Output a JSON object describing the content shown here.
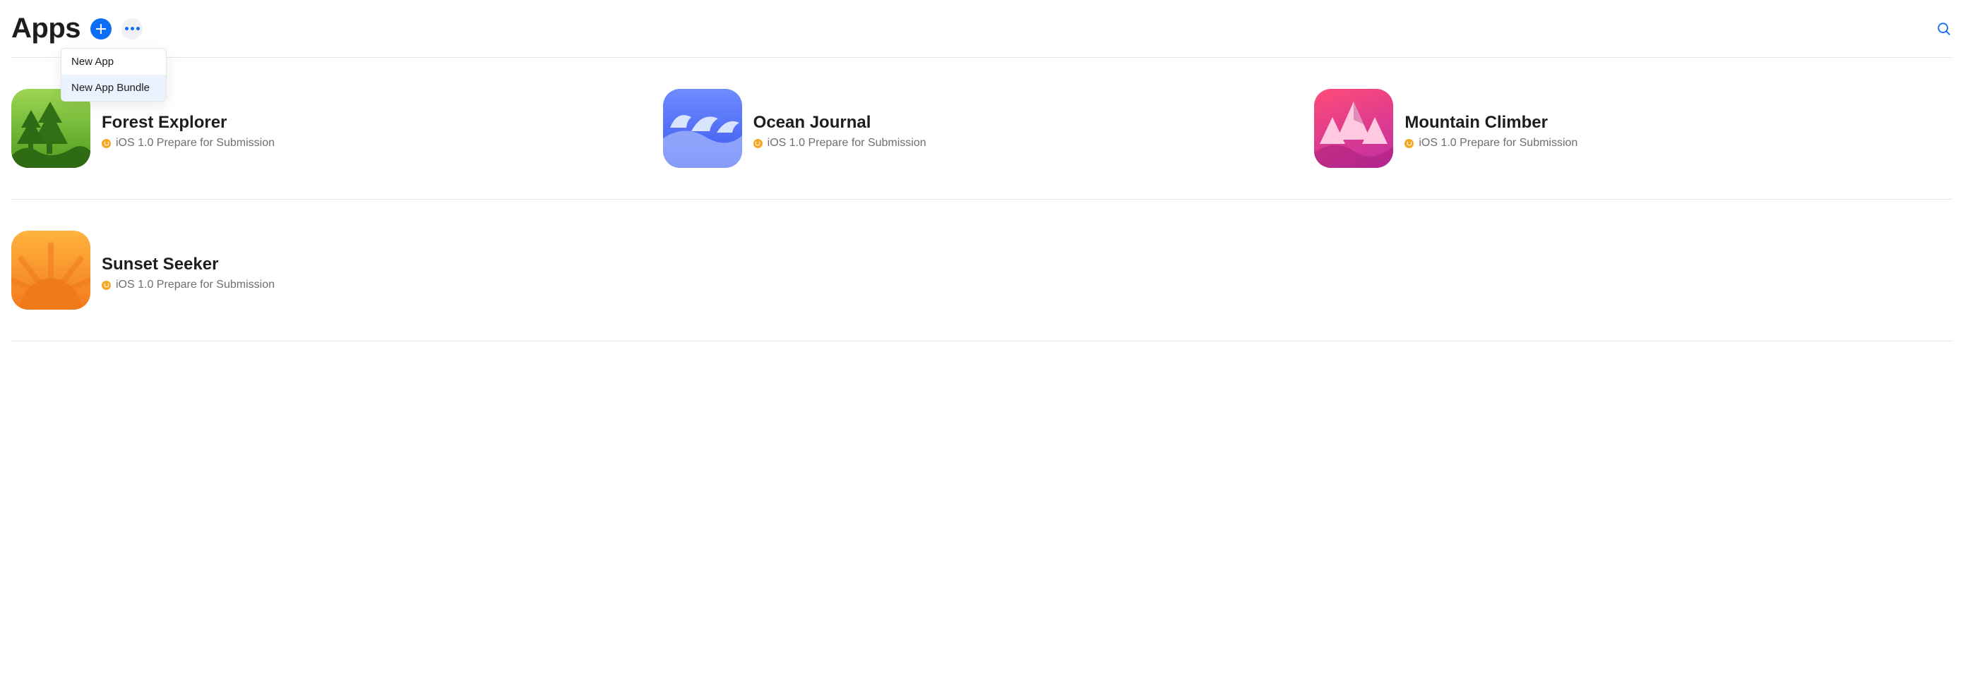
{
  "header": {
    "title": "Apps"
  },
  "dropdown": {
    "items": [
      {
        "label": "New App"
      },
      {
        "label": "New App Bundle"
      }
    ]
  },
  "apps": [
    {
      "name": "Forest Explorer",
      "status": "iOS 1.0 Prepare for Submission"
    },
    {
      "name": "Ocean Journal",
      "status": "iOS 1.0 Prepare for Submission"
    },
    {
      "name": "Mountain Climber",
      "status": "iOS 1.0 Prepare for Submission"
    },
    {
      "name": "Sunset Seeker",
      "status": "iOS 1.0 Prepare for Submission"
    }
  ]
}
